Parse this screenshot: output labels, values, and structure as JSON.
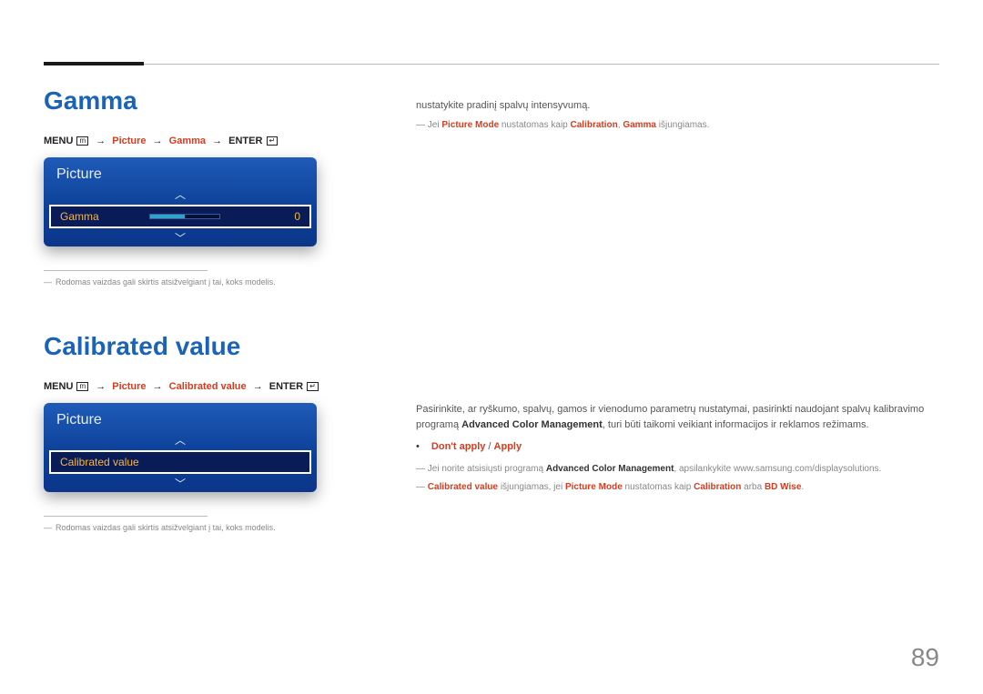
{
  "pageNumber": "89",
  "section1": {
    "title": "Gamma",
    "breadcrumb": {
      "menu": "MENU",
      "menuIcon": "m",
      "step1": "Picture",
      "step2": "Gamma",
      "enter": "ENTER",
      "enterIcon": "↵"
    },
    "panel": {
      "title": "Picture",
      "rowLabel": "Gamma",
      "rowValue": "0"
    },
    "imgNote": "Rodomas vaizdas gali skirtis atsižvelgiant į tai, koks modelis.",
    "descLine1": "nustatykite pradinį spalvų intensyvumą.",
    "note1_a": "Jei ",
    "note1_b": "Picture Mode",
    "note1_c": " nustatomas kaip ",
    "note1_d": "Calibration",
    "note1_e": ", ",
    "note1_f": "Gamma",
    "note1_g": " išjungiamas."
  },
  "section2": {
    "title": "Calibrated value",
    "breadcrumb": {
      "menu": "MENU",
      "menuIcon": "m",
      "step1": "Picture",
      "step2": "Calibrated value",
      "enter": "ENTER",
      "enterIcon": "↵"
    },
    "panel": {
      "title": "Picture",
      "rowLabel": "Calibrated value"
    },
    "imgNote": "Rodomas vaizdas gali skirtis atsižvelgiant į tai, koks modelis.",
    "para1_a": "Pasirinkite, ar ryškumo, spalvų, gamos ir vienodumo parametrų nustatymai, pasirinkti naudojant spalvų kalibravimo programą ",
    "para1_b": "Advanced Color Management",
    "para1_c": ", turi būti taikomi veikiant informacijos ir reklamos režimams.",
    "bullet1_a": "Don't apply",
    "bullet1_sep": " / ",
    "bullet1_b": "Apply",
    "note1_a": "Jei norite atsisiųsti programą ",
    "note1_b": "Advanced Color Management",
    "note1_c": ", apsilankykite www.samsung.com/displaysolutions.",
    "note2_a": "Calibrated value",
    "note2_b": " išjungiamas, jei ",
    "note2_c": "Picture Mode",
    "note2_d": " nustatomas kaip ",
    "note2_e": "Calibration",
    "note2_f": " arba ",
    "note2_g": "BD Wise",
    "note2_h": "."
  }
}
